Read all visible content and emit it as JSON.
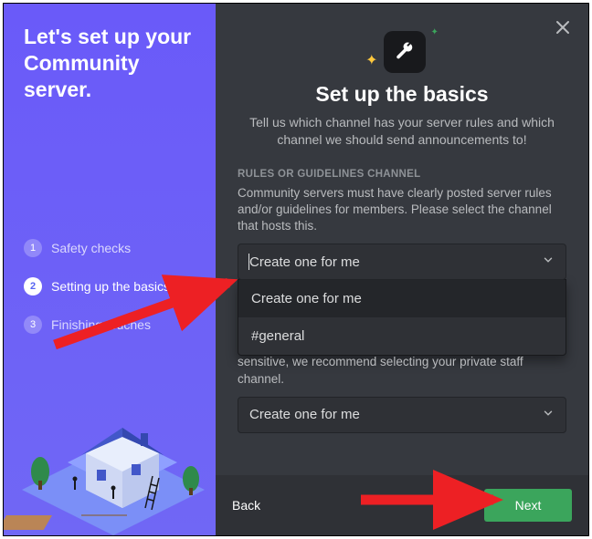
{
  "sidebar": {
    "title": "Let's set up your Community server.",
    "steps": [
      {
        "num": "1",
        "label": "Safety checks"
      },
      {
        "num": "2",
        "label": "Setting up the basics"
      },
      {
        "num": "3",
        "label": "Finishing touches"
      }
    ]
  },
  "main": {
    "heading": "Set up the basics",
    "subtitle": "Tell us which channel has your server rules and which channel we should send announcements to!",
    "section1": {
      "label": "RULES OR GUIDELINES CHANNEL",
      "desc": "Community servers must have clearly posted server rules and/or guidelines for members. Please select the channel that hosts this.",
      "selected": "Create one for me",
      "options": [
        "Create one for me",
        "#general"
      ]
    },
    "section2": {
      "desc_partial": "sensitive, we recommend selecting your private staff channel.",
      "selected": "Create one for me"
    }
  },
  "footer": {
    "back": "Back",
    "next": "Next"
  },
  "colors": {
    "accent": "#5865f2",
    "green": "#3ba55c",
    "bg_dark": "#36393f",
    "arrow": "#ed2024"
  }
}
